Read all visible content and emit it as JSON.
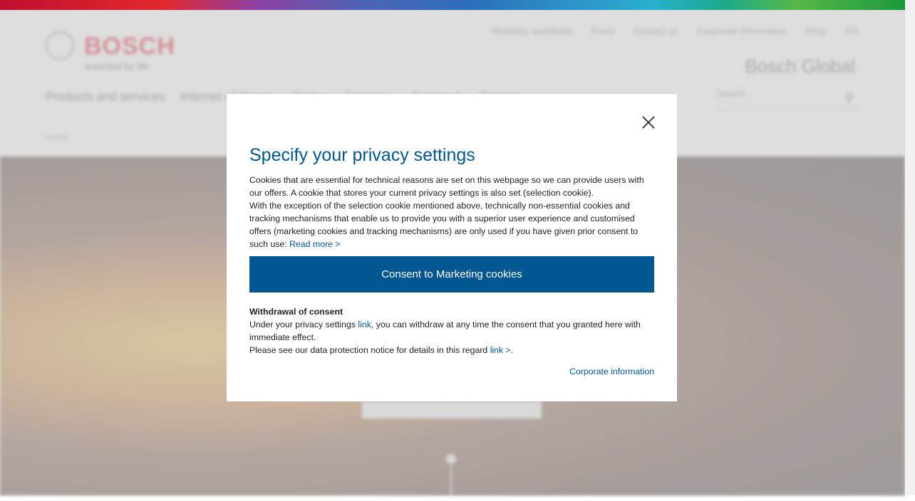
{
  "header": {
    "brand_name": "BOSCH",
    "brand_tagline": "Invented for life",
    "meta_nav": [
      "Websites worldwide",
      "Press",
      "Contact us",
      "Corporate Information",
      "Shop"
    ],
    "language": "EN",
    "site_name": "Bosch Global",
    "main_nav": [
      "Products and services",
      "Internet of Things",
      "Stories",
      "Company",
      "Research",
      "Careers"
    ],
    "search_placeholder": "Search",
    "breadcrumb": "Home"
  },
  "modal": {
    "title": "Specify your privacy settings",
    "intro_1": "Cookies that are essential for technical reasons are set on this webpage so we can provide users with our offers. A cookie that stores your current privacy settings is also set (selection cookie).",
    "intro_2": "With the exception of the selection cookie mentioned above, technically non-essential cookies and tracking mechanisms that enable us to provide you with a superior user experience and customised offers (marketing cookies and tracking mechanisms) are only used if you have given prior consent to such use: ",
    "read_more_link": "Read more >",
    "consent_button": "Consent to Marketing cookies",
    "withdrawal_heading": "Withdrawal of consent",
    "withdrawal_text_1": "Under your privacy settings ",
    "withdrawal_link": "link",
    "withdrawal_text_2": ", you can withdraw at any time the consent that you granted here with immediate effect.",
    "notice_text": "Please see our data protection notice for details in this regard ",
    "notice_link": "link >",
    "notice_end": ".",
    "corporate_link": "Corporate information"
  },
  "colors": {
    "accent": "#005691",
    "brand_red": "#e0001b"
  }
}
